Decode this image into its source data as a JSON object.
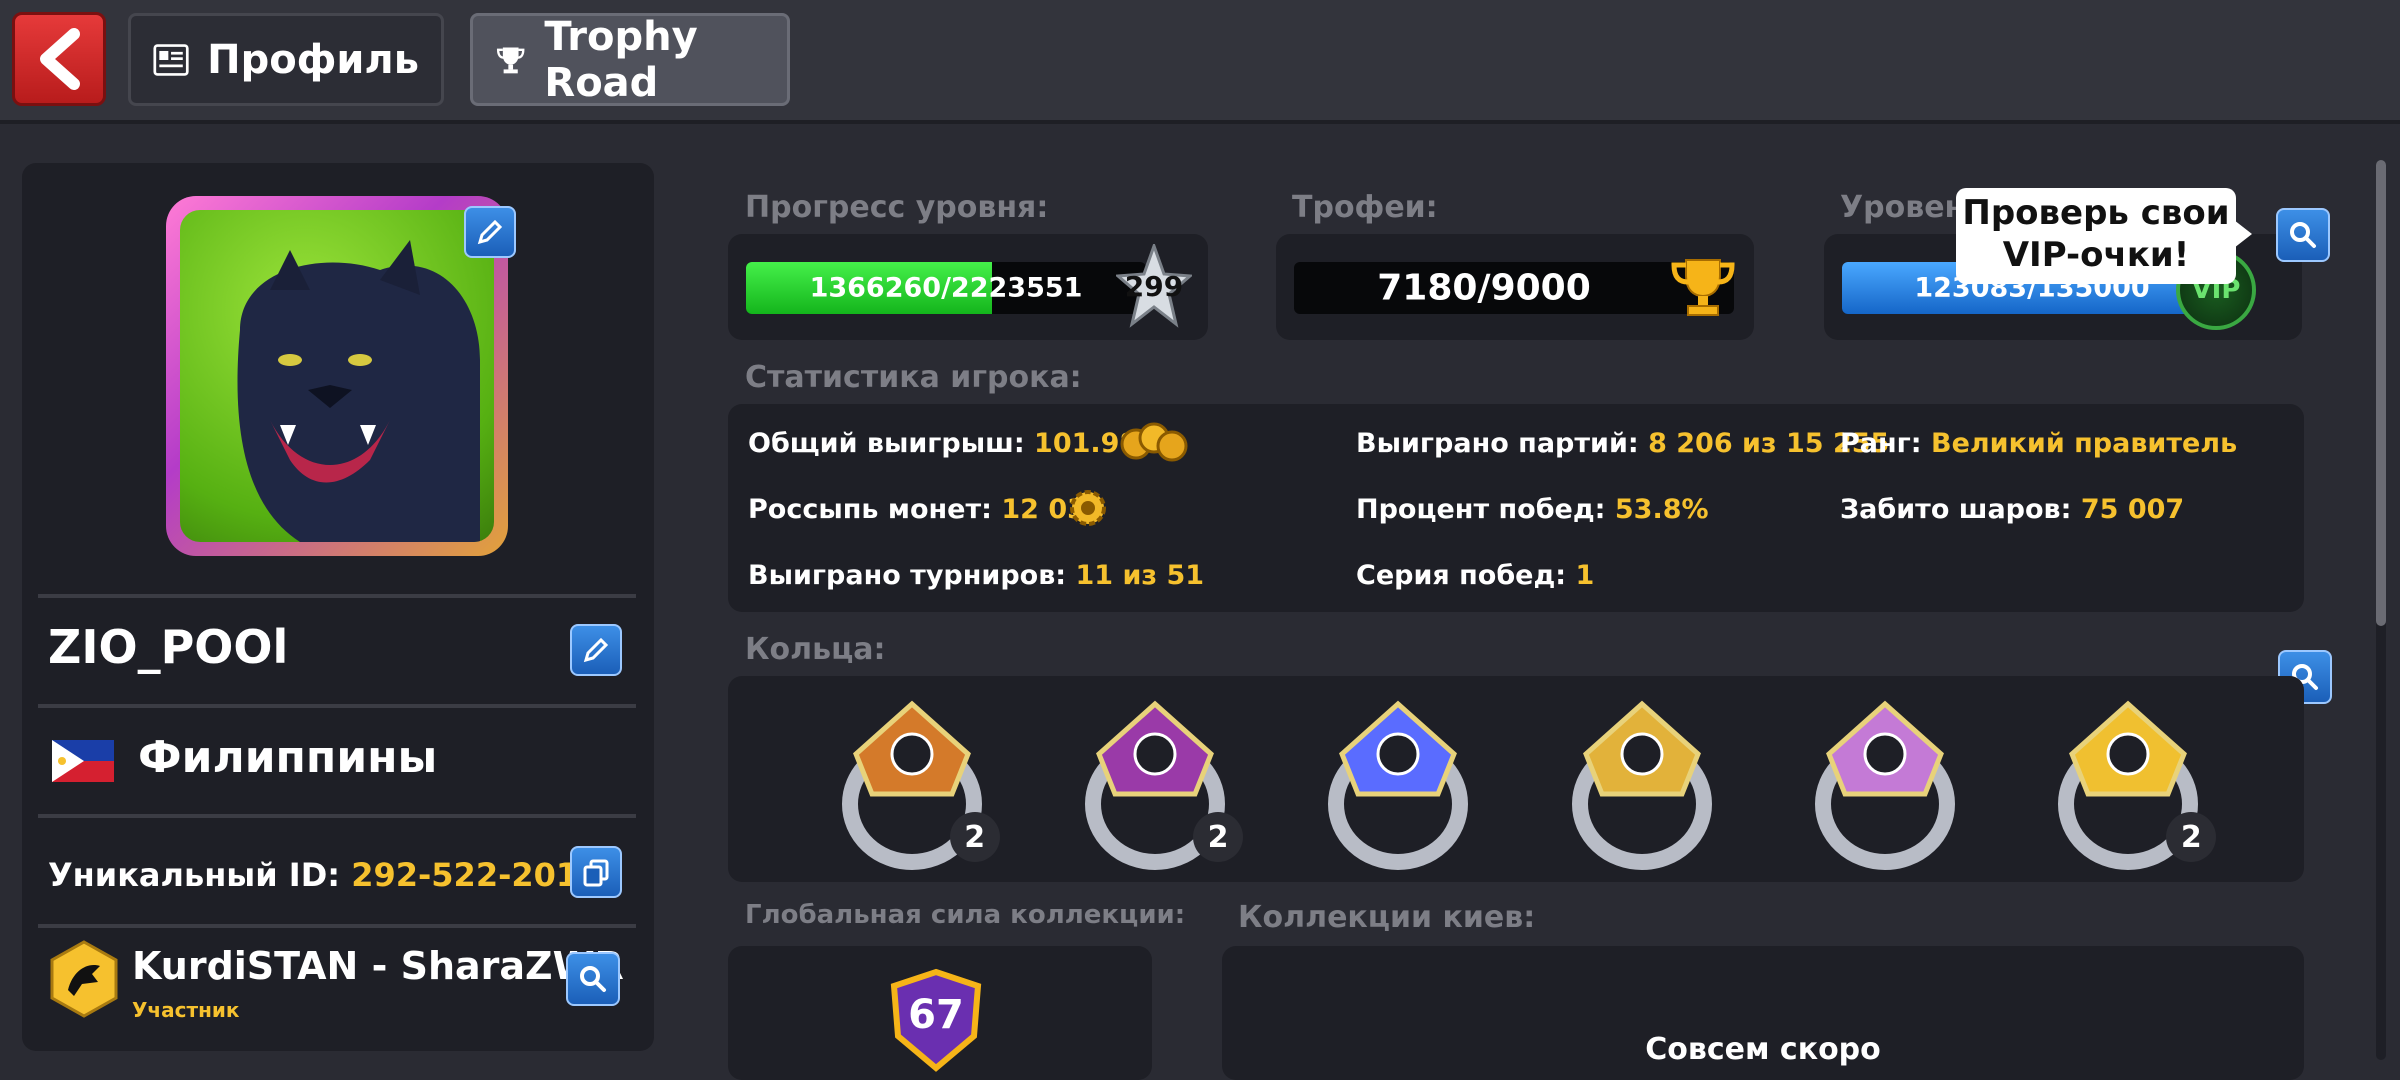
{
  "header": {
    "profile_tab": "Профиль",
    "trophy_tab": "Trophy Road"
  },
  "profile": {
    "name": "ZIO_POOl",
    "country": "Филиппины",
    "uid_label": "Уникальный ID:",
    "uid_value": "292-522-201-9",
    "club_name": "KurdiSTAN - SharaZWR",
    "club_role": "Участник"
  },
  "level": {
    "label": "Прогресс уровня:",
    "progress_text": "1366260/2223551",
    "progress_fraction": 0.614,
    "level_number": "299"
  },
  "trophies": {
    "label": "Трофеи:",
    "value": "7180/9000"
  },
  "vip": {
    "label": "Уровень",
    "progress_text": "123083/135000",
    "progress_fraction": 0.912,
    "badge": "VIP",
    "tooltip_line1": "Проверь свои",
    "tooltip_line2": "VIP-очки!"
  },
  "stats": {
    "label": "Статистика игрока:",
    "total_win_label": "Общий выигрыш:",
    "total_win_value": "101.98B",
    "coin_scatter_label": "Россыпь монет:",
    "coin_scatter_value": "12 038",
    "tournaments_label": "Выиграно турниров:",
    "tournaments_value": "11 из 51",
    "games_won_label": "Выиграно партий:",
    "games_won_value": "8 206 из 15 255",
    "win_pct_label": "Процент побед:",
    "win_pct_value": "53.8%",
    "streak_label": "Серия побед:",
    "streak_value": "1",
    "rank_label": "Ранг:",
    "rank_value": "Великий правитель",
    "balls_label": "Забито шаров:",
    "balls_value": "75 007"
  },
  "rings": {
    "label": "Кольца:",
    "items": [
      {
        "count": "2",
        "color": "#d47a2a"
      },
      {
        "count": "2",
        "color": "#9a3aa8"
      },
      {
        "count": "",
        "color": "#5a6cff"
      },
      {
        "count": "",
        "color": "#e2b23a"
      },
      {
        "count": "",
        "color": "#c47ad6"
      },
      {
        "count": "2",
        "color": "#f0c030"
      }
    ]
  },
  "collection": {
    "power_label": "Глобальная сила коллекции:",
    "power_value": "67",
    "cues_label": "Коллекции киев:",
    "cues_soon": "Совсем скоро"
  },
  "colors": {
    "accent_yellow": "#f6c12e",
    "progress_green": "#22d32a",
    "vip_blue": "#2a8ff0"
  }
}
